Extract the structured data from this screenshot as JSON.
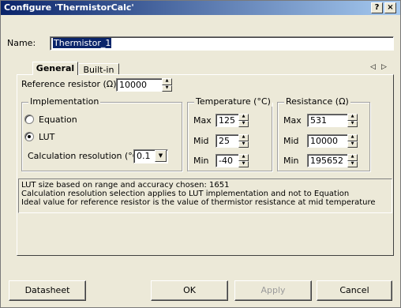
{
  "window": {
    "title": "Configure 'ThermistorCalc'",
    "help_glyph": "?",
    "close_glyph": "×"
  },
  "name": {
    "label": "Name:",
    "value": "Thermistor_1"
  },
  "tabs": [
    {
      "label": "General",
      "active": true
    },
    {
      "label": "Built-in",
      "active": false
    }
  ],
  "tab_nav": {
    "prev": "◁",
    "next": "▷"
  },
  "reference": {
    "label": "Reference resistor (Ω):",
    "value": "10000"
  },
  "implementation": {
    "title": "Implementation",
    "equation_label": "Equation",
    "lut_label": "LUT",
    "selected": "LUT",
    "resolution_label": "Calculation resolution (°C):",
    "resolution_value": "0.1"
  },
  "temperature": {
    "title": "Temperature (°C)",
    "max_label": "Max",
    "max_value": "125",
    "mid_label": "Mid",
    "mid_value": "25",
    "min_label": "Min",
    "min_value": "-40"
  },
  "resistance": {
    "title": "Resistance (Ω)",
    "max_label": "Max",
    "max_value": "531",
    "mid_label": "Mid",
    "mid_value": "10000",
    "min_label": "Min",
    "min_value": "195652"
  },
  "info_lines": [
    "LUT size based on range and accuracy chosen: 1651",
    "Calculation resolution selection applies to LUT implementation and not to Equation",
    "Ideal value for reference resistor is the value of thermistor resistance at mid temperature"
  ],
  "buttons": {
    "datasheet": "Datasheet",
    "ok": "OK",
    "apply": "Apply",
    "cancel": "Cancel"
  }
}
